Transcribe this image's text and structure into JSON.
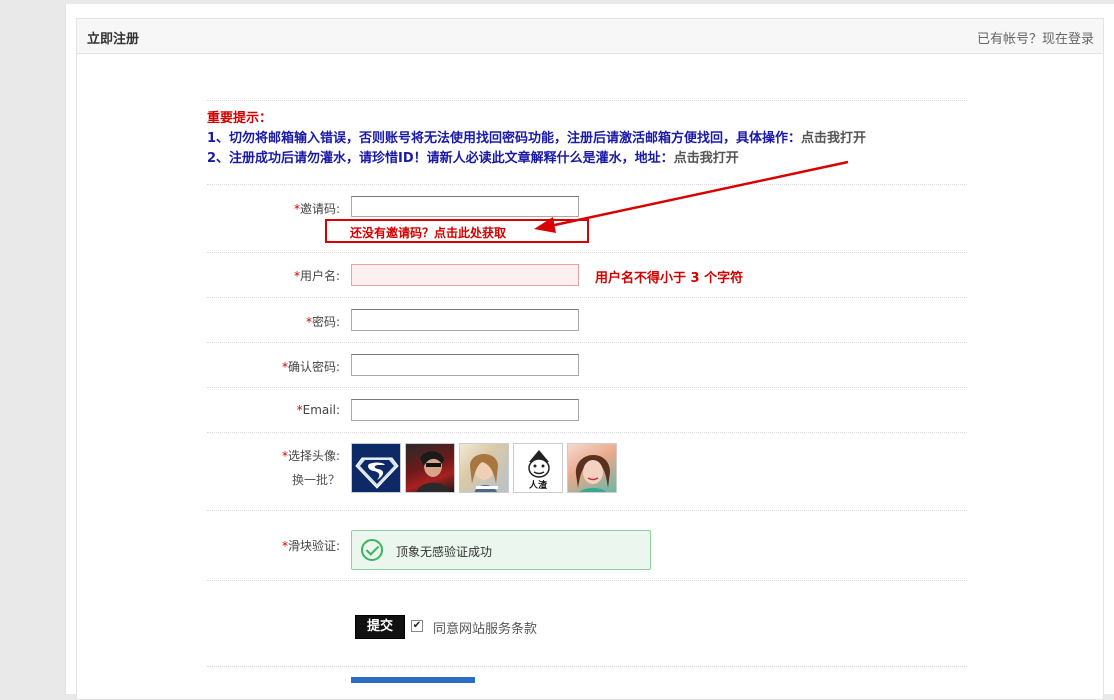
{
  "header": {
    "title": "立即注册",
    "login_link": "已有帐号？现在登录"
  },
  "notice": {
    "title": "重要提示：",
    "line1": "1、切勿将邮箱输入错误，否则账号将无法使用找回密码功能，注册后请激活邮箱方便找回，具体操作：",
    "line1_link": "点击我打开",
    "line2": "2、注册成功后请勿灌水，请珍惜ID！请新人必读此文章解释什么是灌水，地址：",
    "line2_link": "点击我打开"
  },
  "form": {
    "required_mark": "*",
    "invite": {
      "label": "邀请码:",
      "value": "",
      "link": "还没有邀请码？点击此处获取"
    },
    "username": {
      "label": "用户名:",
      "value": "",
      "error": "用户名不得小于 3 个字符"
    },
    "password": {
      "label": "密码:",
      "value": ""
    },
    "confirm_password": {
      "label": "确认密码:",
      "value": ""
    },
    "email": {
      "label": "Email:",
      "value": ""
    },
    "avatar": {
      "label": "选择头像:",
      "change": "换一批？",
      "avatar4_caption": "人渣"
    },
    "slider": {
      "label": "滑块验证:",
      "status": "顶象无感验证成功"
    },
    "submit_label": "提交",
    "agree_checked": "✔",
    "agree_label": "同意网站服务条款"
  },
  "colors": {
    "required": "#d40000",
    "notice_blue": "#1a1aa8",
    "highlight_red": "#d80000",
    "success_green": "#3cb35c"
  }
}
